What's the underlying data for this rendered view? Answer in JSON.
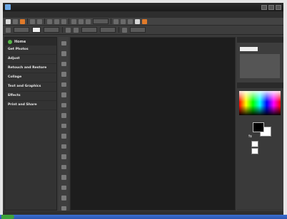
{
  "window": {
    "title": ""
  },
  "menu": {
    "items": [
      "",
      "",
      "",
      "",
      "",
      "",
      "",
      "",
      "",
      ""
    ]
  },
  "left_panel": {
    "title": "Home",
    "tasks": [
      {
        "title": "Get Photos",
        "desc": ""
      },
      {
        "title": "Adjust",
        "desc": ""
      },
      {
        "title": "Retouch and Restore",
        "desc": ""
      },
      {
        "title": "Collage",
        "desc": ""
      },
      {
        "title": "Text and Graphics",
        "desc": ""
      },
      {
        "title": "Effects",
        "desc": ""
      },
      {
        "title": "Print and Share",
        "desc": ""
      }
    ]
  },
  "right_panels": {
    "navigator": {
      "title": "",
      "zoom": ""
    },
    "color": {
      "title": ""
    }
  },
  "colors": {
    "background": "#3a3a3a",
    "canvas": "#1d1d1d",
    "accent_orange": "#e07a2a",
    "home_green": "#58b848",
    "taskbar_blue": "#3b6fd1"
  },
  "icons": {
    "home": "home-icon",
    "swap": "swap-colors-icon"
  }
}
